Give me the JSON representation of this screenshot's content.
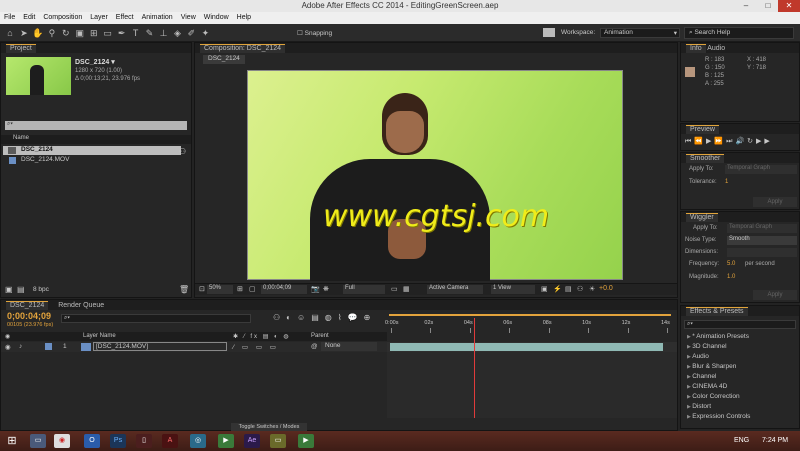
{
  "window": {
    "title": "Adobe After Effects CC 2014 - EditingGreenScreen.aep",
    "minimize": "–",
    "maximize": "□",
    "close": "✕"
  },
  "menu": [
    "File",
    "Edit",
    "Composition",
    "Layer",
    "Effect",
    "Animation",
    "View",
    "Window",
    "Help"
  ],
  "toolbar": {
    "snapping": "Snapping",
    "workspace_label": "Workspace:",
    "workspace_value": "Animation",
    "search_placeholder": "Search Help"
  },
  "project": {
    "tab": "Project",
    "item_name": "DSC_2124 ▾",
    "item_info1": "1280 x 720 (1.00)",
    "item_info2": "Δ 0;00:13;21, 23.976 fps",
    "search_placeholder": "⌕▾",
    "col_name": "Name",
    "items": [
      "DSC_2124",
      "DSC_2124.MOV"
    ],
    "bpc": "8 bpc"
  },
  "composition": {
    "tab": "Composition: DSC_2124",
    "subtab": "DSC_2124",
    "watermark": "www.cgtsj.com",
    "zoom": "50%",
    "timecode": "0;00:04;09",
    "resolution": "Full",
    "camera": "Active Camera",
    "views": "1 View",
    "offset": "+0.0"
  },
  "info": {
    "tab": "Info",
    "tab2": "Audio",
    "r": "R : 183",
    "g": "G : 150",
    "b": "B : 125",
    "a": "A : 255",
    "x": "X : 418",
    "y": "Y : 718",
    "swatch": "#b7967d"
  },
  "preview": {
    "tab": "Preview"
  },
  "smoother": {
    "tab": "Smoother",
    "apply_to_label": "Apply To:",
    "apply_to_value": "Temporal Graph",
    "tolerance_label": "Tolerance:",
    "tolerance_value": "1",
    "apply": "Apply"
  },
  "wiggler": {
    "tab": "Wiggler",
    "apply_to_label": "Apply To:",
    "apply_to_value": "Temporal Graph",
    "noise_label": "Noise Type:",
    "noise_value": "Smooth",
    "dimensions_label": "Dimensions:",
    "frequency_label": "Frequency:",
    "frequency_value": "5.0",
    "frequency_unit": "per second",
    "magnitude_label": "Magnitude:",
    "magnitude_value": "1.0",
    "apply": "Apply"
  },
  "effects": {
    "tab": "Effects & Presets",
    "search_placeholder": "⌕▾",
    "items": [
      "* Animation Presets",
      "3D Channel",
      "Audio",
      "Blur & Sharpen",
      "Channel",
      "CINEMA 4D",
      "Color Correction",
      "Distort",
      "Expression Controls"
    ]
  },
  "timeline": {
    "tab": "DSC_2124",
    "tab2": "Render Queue",
    "timecode": "0;00:04;09",
    "frames": "00105 (23.976 fps)",
    "col_layer": "Layer Name",
    "col_parent": "Parent",
    "layer_num": "1",
    "layer_name": "[DSC_2124.MOV]",
    "parent_value": "None",
    "ticks": [
      "0:00s",
      "02s",
      "04s",
      "06s",
      "08s",
      "10s",
      "12s",
      "14s"
    ],
    "toggle": "Toggle Switches / Modes",
    "playhead_fraction": 0.3
  },
  "taskbar": {
    "lang": "ENG",
    "time": "7:24 PM"
  }
}
